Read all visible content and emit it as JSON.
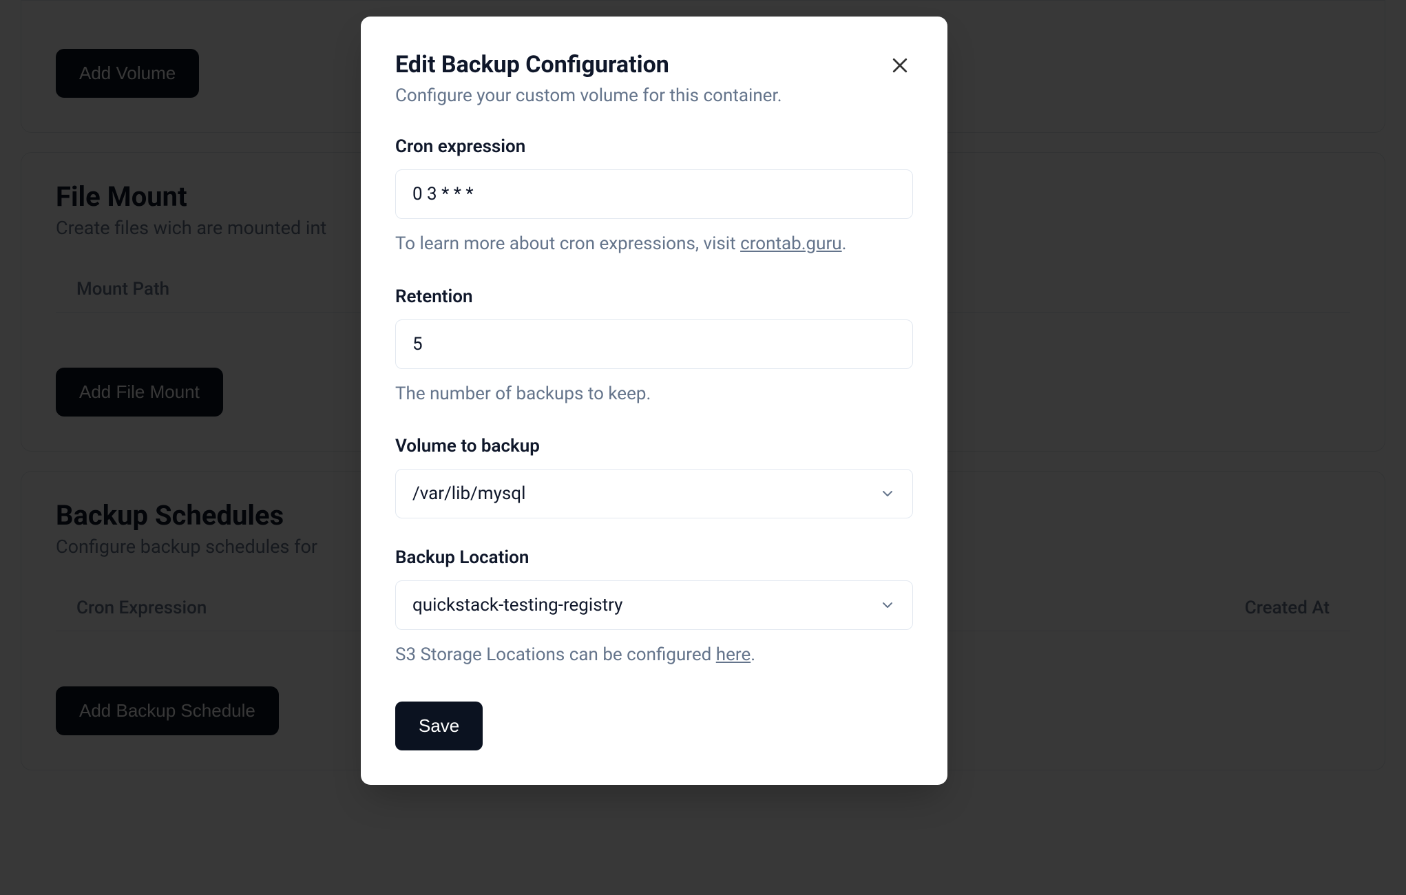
{
  "background": {
    "volume_section": {
      "add_button": "Add Volume"
    },
    "filemount_section": {
      "title": "File Mount",
      "subtitle": "Create files wich are mounted int",
      "col_mount_path": "Mount Path",
      "add_button": "Add File Mount"
    },
    "backup_section": {
      "title": "Backup Schedules",
      "subtitle": "Configure backup schedules for",
      "col_cron": "Cron Expression",
      "col_created": "Created At",
      "add_button": "Add Backup Schedule"
    }
  },
  "modal": {
    "title": "Edit Backup Configuration",
    "description": "Configure your custom volume for this container.",
    "cron": {
      "label": "Cron expression",
      "value": "0 3 * * *",
      "help_prefix": "To learn more about cron expressions, visit ",
      "help_link": "crontab.guru",
      "help_suffix": "."
    },
    "retention": {
      "label": "Retention",
      "value": "5",
      "help": "The number of backups to keep."
    },
    "volume": {
      "label": "Volume to backup",
      "value": "/var/lib/mysql"
    },
    "location": {
      "label": "Backup Location",
      "value": "quickstack-testing-registry",
      "help_prefix": "S3 Storage Locations can be configured ",
      "help_link": "here",
      "help_suffix": "."
    },
    "save_label": "Save"
  }
}
